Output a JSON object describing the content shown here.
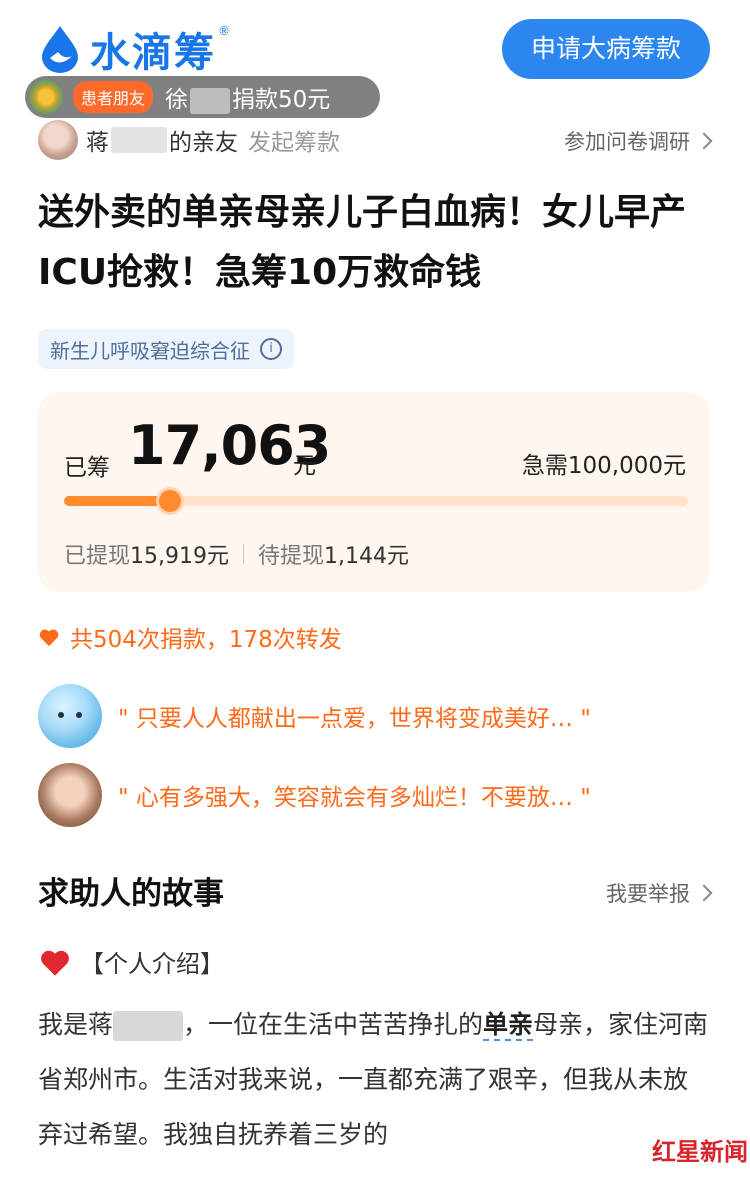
{
  "header": {
    "logo_text": "水滴筹",
    "logo_mark": "®",
    "apply_button": "申请大病筹款"
  },
  "toast": {
    "badge": "患者朋友",
    "name_prefix": "徐",
    "action": "捐款50元"
  },
  "starter": {
    "name_prefix": "蒋",
    "relation": "的亲友",
    "action": "发起筹款"
  },
  "survey_link": "参加问卷调研",
  "title": "送外卖的单亲母亲儿子白血病！女儿早产ICU抢救！急筹10万救命钱",
  "tag": "新生儿呼吸窘迫综合征",
  "progress": {
    "raised_label": "已筹",
    "raised_amount": "17,063",
    "unit": "元",
    "target_text": "急需100,000元",
    "raised_fraction": 0.17,
    "withdrawn_label": "已提现",
    "withdrawn_amount": "15,919元",
    "pending_label": "待提现",
    "pending_amount": "1,144元"
  },
  "stats_text": "共504次捐款，178次转发",
  "comments": [
    {
      "text": "\" 只要人人都献出一点爱，世界将变成美好…   \""
    },
    {
      "text": "\" 心有多强大，笑容就会有多灿烂！不要放…   \""
    }
  ],
  "story": {
    "title": "求助人的故事",
    "report_link": "我要举报",
    "section": "【个人介绍】",
    "p1_a": "我是蒋",
    "p1_b": "，一位在生活中苦苦挣扎的",
    "p1_hl": "单亲",
    "p1_c": "母亲，家住河南省郑州市。生活对我来说，一直都充满了艰辛，但我从未放弃过希望。我独自抚养着三岁的"
  },
  "watermark": {
    "brand": "红星新闻"
  },
  "colors": {
    "brand_blue": "#1976e8",
    "accent_orange": "#ff6a1a",
    "card_bg": "#fff6f0"
  }
}
